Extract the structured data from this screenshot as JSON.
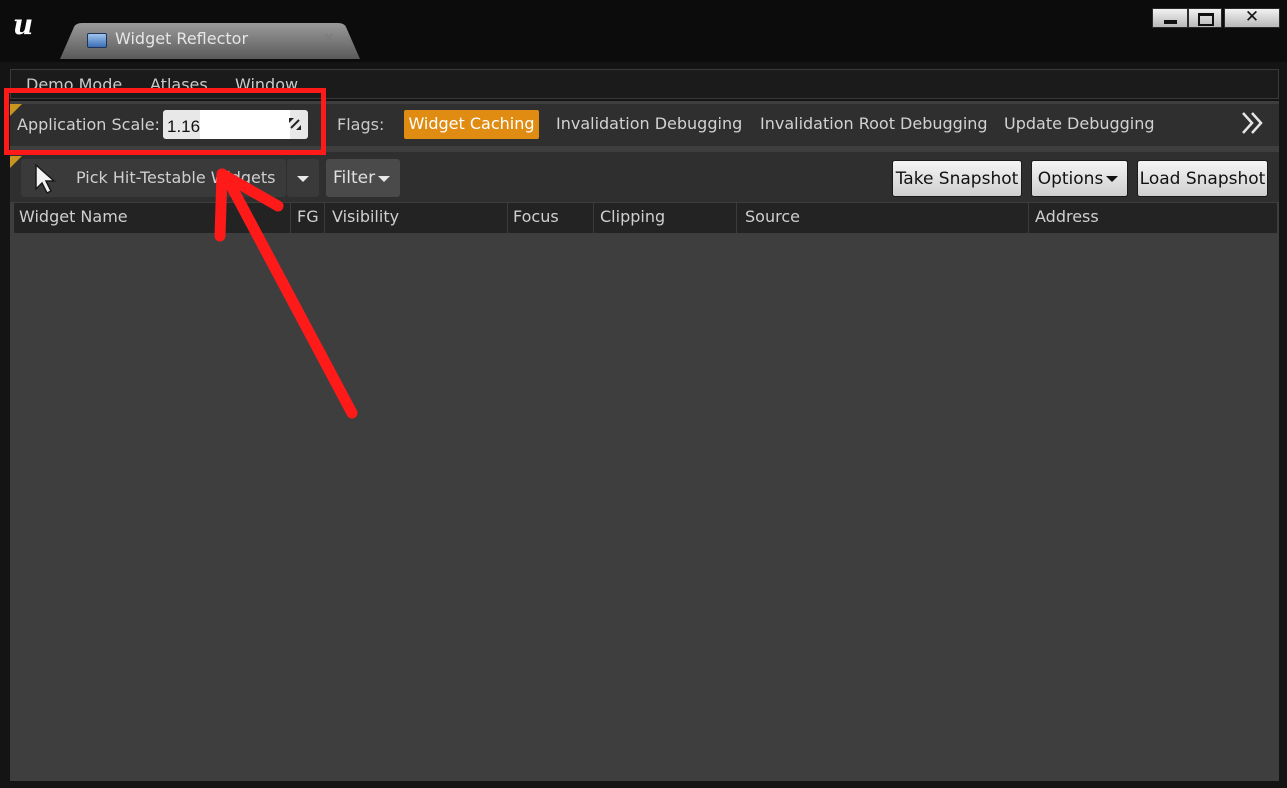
{
  "window": {
    "tab_title": "Widget Reflector",
    "tab_close": "×",
    "close_glyph": "✕"
  },
  "menu": [
    "Demo Mode",
    "Atlases",
    "Window"
  ],
  "scale": {
    "label": "Application Scale:",
    "value": "1.16"
  },
  "flags": {
    "label": "Flags:",
    "items": [
      "Widget Caching",
      "Invalidation Debugging",
      "Invalidation Root Debugging",
      "Update Debugging"
    ],
    "active": "Widget Caching"
  },
  "toolbar": {
    "pick_label": "Pick Hit-Testable Widgets",
    "filter_label": "Filter",
    "take_snapshot": "Take Snapshot",
    "options": "Options",
    "load_snapshot": "Load Snapshot"
  },
  "table": {
    "columns": [
      "Widget Name",
      "FG",
      "Visibility",
      "Focus",
      "Clipping",
      "Source",
      "Address"
    ]
  },
  "colors": {
    "accent": "#e08c12",
    "annotation": "#ff1a1a"
  }
}
